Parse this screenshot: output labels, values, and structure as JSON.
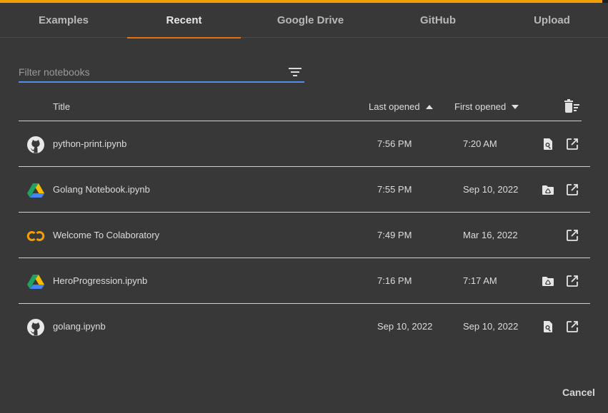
{
  "tabs": [
    {
      "label": "Examples",
      "active": false
    },
    {
      "label": "Recent",
      "active": true
    },
    {
      "label": "Google Drive",
      "active": false
    },
    {
      "label": "GitHub",
      "active": false
    },
    {
      "label": "Upload",
      "active": false
    }
  ],
  "filter": {
    "placeholder": "Filter notebooks",
    "value": ""
  },
  "table": {
    "columns": {
      "title": "Title",
      "last_opened": "Last opened",
      "first_opened": "First opened"
    },
    "sort": {
      "last_opened": "ascending",
      "first_opened": "descending"
    },
    "rows": [
      {
        "title": "python-print.ipynb",
        "last_opened": "7:56 PM",
        "first_opened": "7:20 AM",
        "source_icon": "github-icon",
        "actions": [
          "preview-icon",
          "open-in-new-tab-icon"
        ]
      },
      {
        "title": "Golang Notebook.ipynb",
        "last_opened": "7:55 PM",
        "first_opened": "Sep 10, 2022",
        "source_icon": "google-drive-icon",
        "actions": [
          "drive-folder-icon",
          "open-in-new-tab-icon"
        ]
      },
      {
        "title": "Welcome To Colaboratory",
        "last_opened": "7:49 PM",
        "first_opened": "Mar 16, 2022",
        "source_icon": "colab-icon",
        "actions": [
          "open-in-new-tab-icon"
        ]
      },
      {
        "title": "HeroProgression.ipynb",
        "last_opened": "7:16 PM",
        "first_opened": "7:17 AM",
        "source_icon": "google-drive-icon",
        "actions": [
          "drive-folder-icon",
          "open-in-new-tab-icon"
        ]
      },
      {
        "title": "golang.ipynb",
        "last_opened": "Sep 10, 2022",
        "first_opened": "Sep 10, 2022",
        "source_icon": "github-icon",
        "actions": [
          "preview-icon",
          "open-in-new-tab-icon"
        ]
      }
    ]
  },
  "footer": {
    "cancel_label": "Cancel"
  },
  "colors": {
    "accent": "#f29f05",
    "tab_underline": "#e8710a",
    "input_focus": "#4f8fe8",
    "background": "#383838"
  }
}
